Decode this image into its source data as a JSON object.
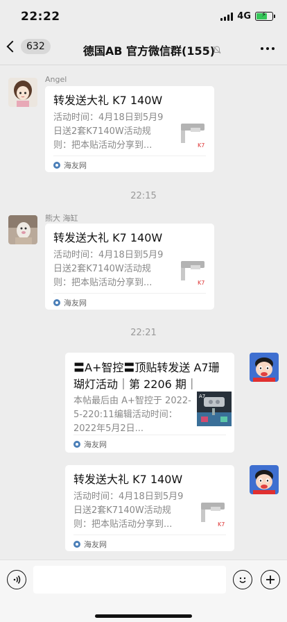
{
  "status": {
    "time": "22:22",
    "network": "4G"
  },
  "nav": {
    "unread_count": "632",
    "title": "德国AB 官方微信群(155)"
  },
  "messages": [
    {
      "sender": "Angel",
      "title": "转发送大礼 K7 140W",
      "desc": "活动时间：4月18日到5月9日送2套K7140W活动规则：把本贴活动分享到...",
      "source": "海友网",
      "thumb_label": "K7"
    },
    {
      "time": "22:15"
    },
    {
      "sender": "熊大 海缸",
      "title": "转发送大礼 K7 140W",
      "desc": "活动时间：4月18日到5月9日送2套K7140W活动规则：把本贴活动分享到...",
      "source": "海友网",
      "thumb_label": "K7"
    },
    {
      "time": "22:21"
    },
    {
      "title": "〓A+智控〓顶贴转发送 A7珊瑚灯活动｜第 2206 期｜",
      "desc": "本帖最后由 A+智控于 2022-5-220:11编辑活动时间：2022年5月2日...",
      "source": "海友网",
      "thumb_label": "A7"
    },
    {
      "title": "转发送大礼 K7 140W",
      "desc": "活动时间：4月18日到5月9日送2套K7140W活动规则：把本贴活动分享到...",
      "source": "海友网",
      "thumb_label": "K7"
    }
  ],
  "input": {
    "placeholder": ""
  },
  "colors": {
    "background": "#ededed",
    "card": "#ffffff",
    "battery": "#35c759"
  }
}
